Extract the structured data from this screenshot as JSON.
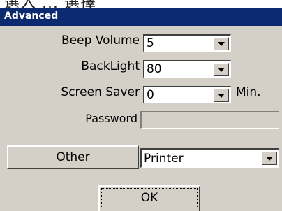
{
  "top_strip_text": "選入 ... 選擇",
  "dialog": {
    "title": "Advanced",
    "beep_volume": {
      "label": "Beep Volume",
      "value": "5"
    },
    "backlight": {
      "label": "BackLight",
      "value": "80"
    },
    "screen_saver": {
      "label": "Screen Saver",
      "value": "0",
      "unit": "Min."
    },
    "password": {
      "label": "Password",
      "value": ""
    },
    "other_button": "Other",
    "other_select": {
      "value": "Printer"
    },
    "ok_button": "OK"
  },
  "colors": {
    "titlebar": "#0b2a6f",
    "dialog_bg": "#d4d0c8"
  },
  "icons": [
    "dropdown-arrow-icon"
  ]
}
